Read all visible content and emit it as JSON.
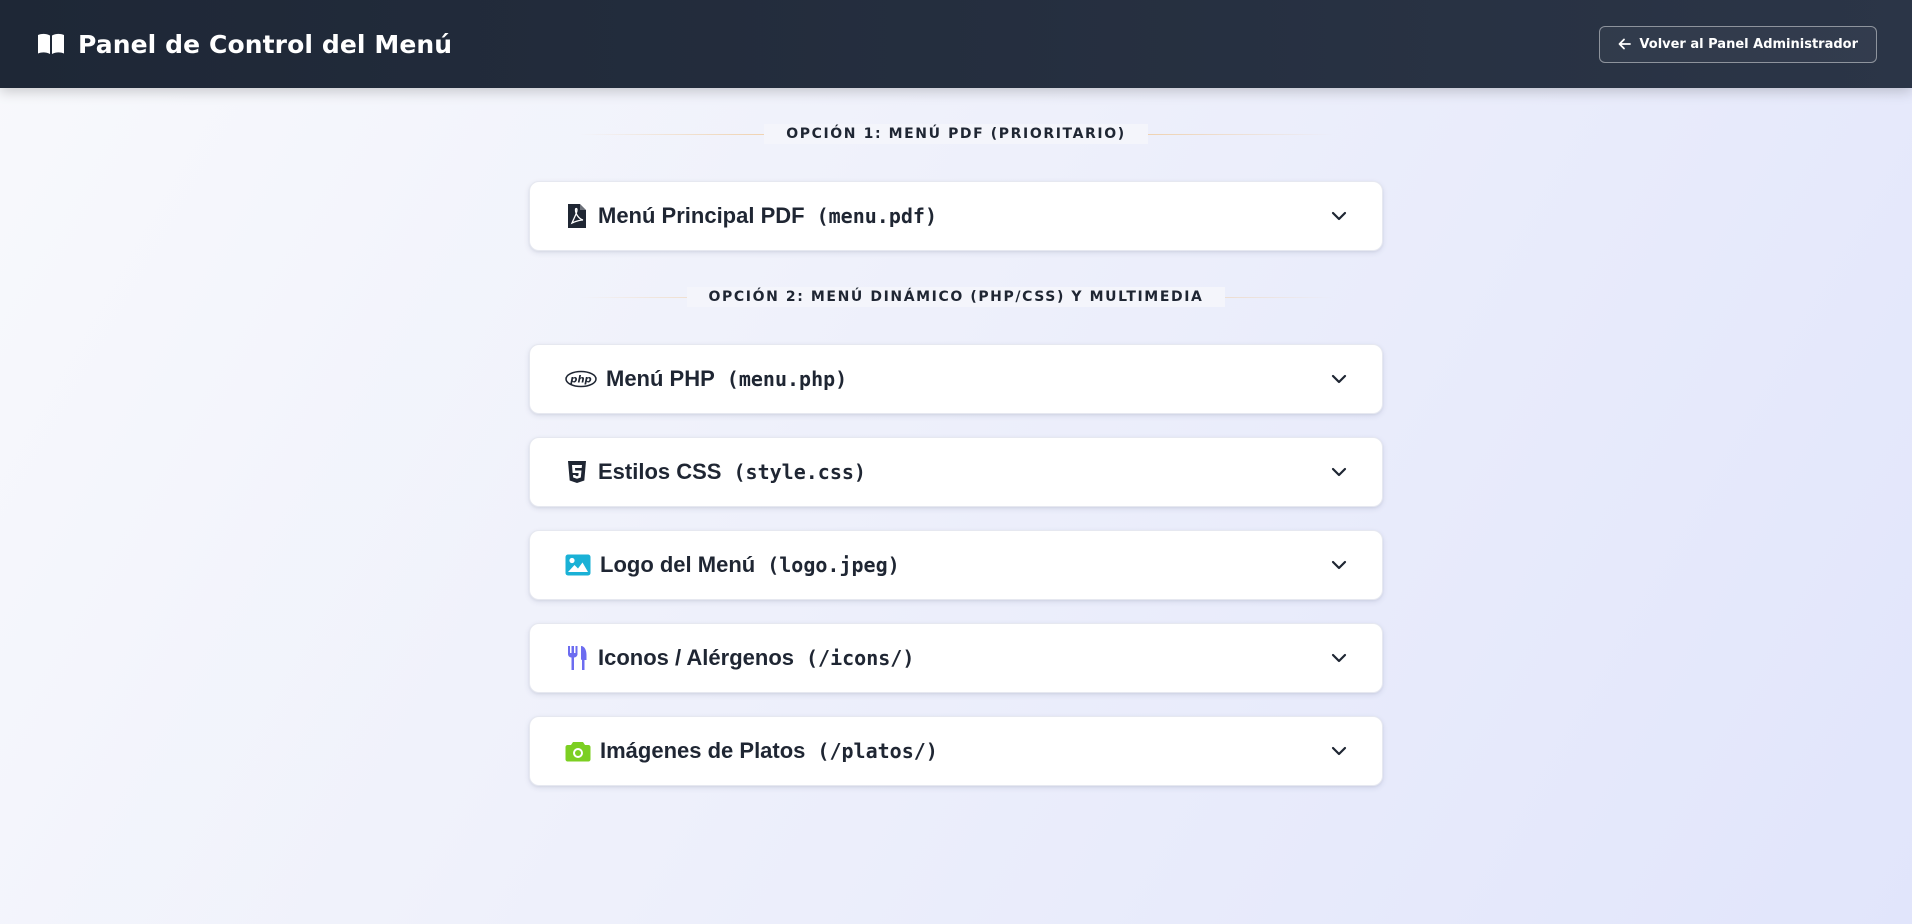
{
  "header": {
    "title": "Panel de Control del Menú",
    "title_icon": "open-book-icon",
    "back_button_label": "Volver al Panel Administrador",
    "back_button_icon": "arrow-left-icon"
  },
  "sections": [
    {
      "label": "OPCIÓN 1: MENÚ PDF (PRIORITARIO)",
      "cards": [
        {
          "title": "Menú Principal PDF",
          "file": "(menu.pdf)",
          "icon": "file-pdf-icon",
          "icon_color": "#1f2633"
        }
      ]
    },
    {
      "label": "OPCIÓN 2: MENÚ DINÁMICO (PHP/CSS) Y MULTIMEDIA",
      "cards": [
        {
          "title": "Menú PHP",
          "file": "(menu.php)",
          "icon": "php-icon",
          "icon_color": "#1f2633"
        },
        {
          "title": "Estilos CSS",
          "file": "(style.css)",
          "icon": "css3-icon",
          "icon_color": "#1f2633"
        },
        {
          "title": "Logo del Menú",
          "file": "(logo.jpeg)",
          "icon": "image-icon",
          "icon_color": "#1ab1d6"
        },
        {
          "title": "Iconos / Alérgenos",
          "file": "(/icons/)",
          "icon": "utensils-icon",
          "icon_color": "#6c6cf0"
        },
        {
          "title": "Imágenes de Platos",
          "file": "(/platos/)",
          "icon": "camera-icon",
          "icon_color": "#7ccf22"
        }
      ]
    }
  ],
  "colors": {
    "header_bg": "#1e2736",
    "card_bg": "#ffffff",
    "text": "#1f2633",
    "divider_line": "#f0c896"
  }
}
